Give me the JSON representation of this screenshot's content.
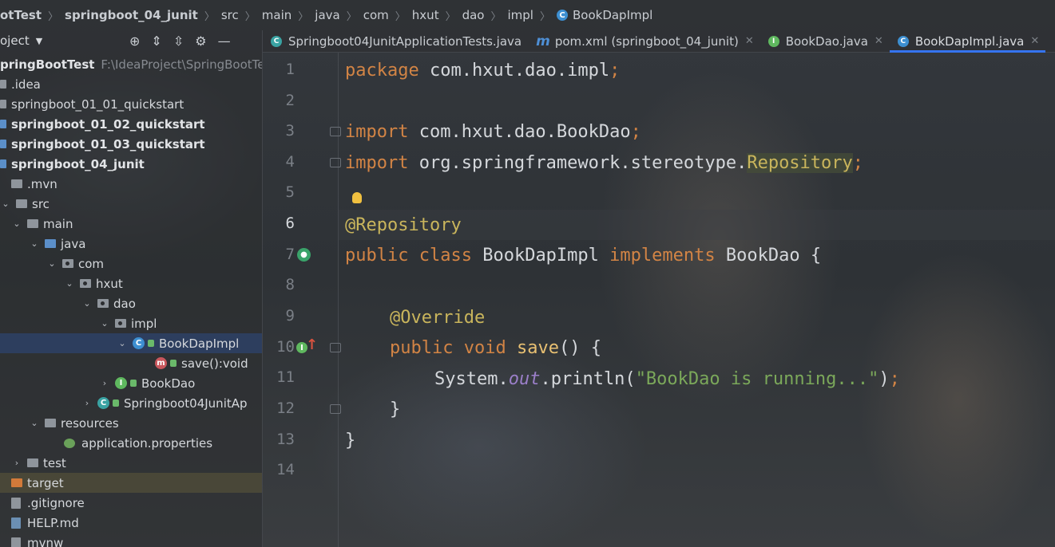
{
  "breadcrumb": {
    "items": [
      "otTest",
      "springboot_04_junit",
      "src",
      "main",
      "java",
      "com",
      "hxut",
      "dao",
      "impl",
      "BookDapImpl"
    ]
  },
  "sidebar": {
    "header_label": "oject",
    "root": {
      "label": "pringBootTest",
      "path": "F:\\IdeaProject\\SpringBootTes"
    },
    "items": [
      {
        "label": ".idea"
      },
      {
        "label": "springboot_01_01_quickstart"
      },
      {
        "label": "springboot_01_02_quickstart"
      },
      {
        "label": "springboot_01_03_quickstart"
      },
      {
        "label": "springboot_04_junit"
      },
      {
        "label": ".mvn"
      },
      {
        "label": "src"
      },
      {
        "label": "main"
      },
      {
        "label": "java"
      },
      {
        "label": "com"
      },
      {
        "label": "hxut"
      },
      {
        "label": "dao"
      },
      {
        "label": "impl"
      },
      {
        "label": "BookDapImpl"
      },
      {
        "label": "save():void"
      },
      {
        "label": "BookDao"
      },
      {
        "label": "Springboot04JunitAp"
      },
      {
        "label": "resources"
      },
      {
        "label": "application.properties"
      },
      {
        "label": "test"
      },
      {
        "label": "target"
      },
      {
        "label": ".gitignore"
      },
      {
        "label": "HELP.md"
      },
      {
        "label": "mvnw"
      }
    ]
  },
  "tabs": [
    {
      "label": "Springboot04JunitApplicationTests.java",
      "icon": "java-run-icon"
    },
    {
      "label": "pom.xml (springboot_04_junit)",
      "icon": "maven-icon"
    },
    {
      "label": "BookDao.java",
      "icon": "interface-icon"
    },
    {
      "label": "BookDapImpl.java",
      "icon": "class-icon",
      "active": true
    }
  ],
  "editor": {
    "line_numbers": [
      "1",
      "2",
      "3",
      "4",
      "5",
      "6",
      "7",
      "8",
      "9",
      "10",
      "11",
      "12",
      "13",
      "14"
    ],
    "code": {
      "l1_kw": "package",
      "l1_rest": " com.hxut.dao.impl",
      "l1_semi": ";",
      "l3_kw": "import",
      "l3_rest": " com.hxut.dao.BookDao",
      "l3_semi": ";",
      "l4_kw": "import",
      "l4_rest": " org.springframework.stereotype.",
      "l4_hl": "Repository",
      "l4_semi": ";",
      "l6_ann": "@Repository",
      "l7_kw1": "public",
      "l7_kw2": " class",
      "l7_name": " BookDapImpl",
      "l7_kw3": " implements",
      "l7_rest": " BookDao {",
      "l9_ann": "@Override",
      "l10_kw1": "public",
      "l10_kw2": " void",
      "l10_fn": " save",
      "l10_rest": "() {",
      "l11_sys": "System.",
      "l11_out": "out",
      "l11_println": ".println(",
      "l11_str": "\"BookDao is running...\"",
      "l11_end": ")",
      "l11_semi": ";",
      "l12": "}",
      "l13": "}"
    }
  }
}
